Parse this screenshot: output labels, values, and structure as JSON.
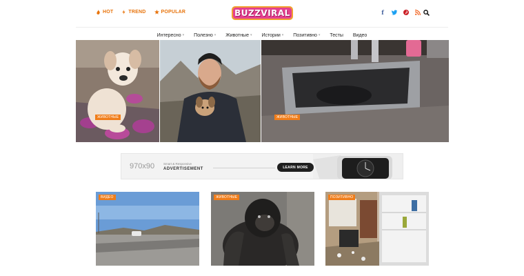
{
  "header": {
    "trends": [
      {
        "label": "HOT",
        "icon": "fire-icon"
      },
      {
        "label": "TREND",
        "icon": "bolt-icon"
      },
      {
        "label": "POPULAR",
        "icon": "star-icon"
      }
    ],
    "logo": "BUZZVIRAL",
    "social": [
      {
        "name": "facebook-icon",
        "glyph": "f",
        "color": "#3b5998"
      },
      {
        "name": "twitter-icon",
        "glyph": "t",
        "color": "#1da1f2"
      },
      {
        "name": "pinterest-icon",
        "glyph": "p",
        "color": "#cb2027"
      },
      {
        "name": "rss-icon",
        "glyph": "r",
        "color": "#f26522"
      }
    ],
    "accent": "#e8740c"
  },
  "nav": {
    "items": [
      {
        "label": "Интересно",
        "has_dropdown": true
      },
      {
        "label": "Полезно",
        "has_dropdown": true
      },
      {
        "label": "Животные",
        "has_dropdown": true
      },
      {
        "label": "Истории",
        "has_dropdown": true
      },
      {
        "label": "Позитивно",
        "has_dropdown": true
      },
      {
        "label": "Тесты",
        "has_dropdown": false
      },
      {
        "label": "Видео",
        "has_dropdown": false
      }
    ]
  },
  "hero": {
    "items": [
      {
        "tag": "ЖИВОТНЫЕ"
      },
      {
        "tag": "ЖИВОТНЫЕ"
      }
    ]
  },
  "ad": {
    "size": "970x90",
    "subtitle": "Smart & Responsive",
    "title": "ADVERTISEMENT",
    "button": "LEARN MORE"
  },
  "cards": [
    {
      "tag": "ВИДЕО"
    },
    {
      "tag": "ЖИВОТНЫЕ"
    },
    {
      "tag": "ПОЗИТИВНО"
    }
  ]
}
